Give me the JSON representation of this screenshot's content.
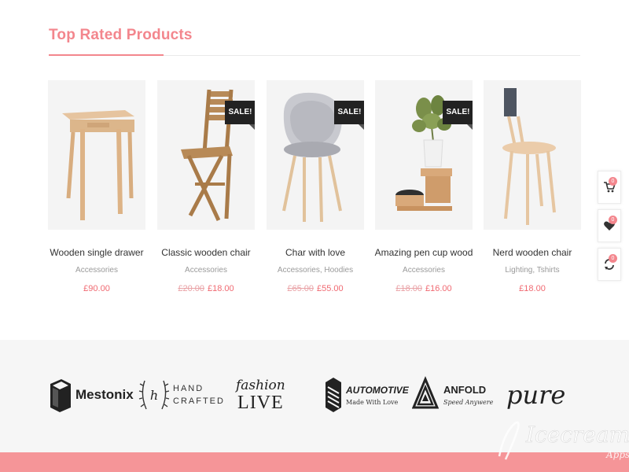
{
  "section": {
    "title": "Top Rated Products"
  },
  "products": [
    {
      "name": "Wooden single drawer",
      "category": "Accessories",
      "old_price": "",
      "price": "£90.00",
      "sale": ""
    },
    {
      "name": "Classic wooden chair",
      "category": "Accessories",
      "old_price": "£20.00",
      "price": "£18.00",
      "sale": "SALE!"
    },
    {
      "name": "Char with love",
      "category": "Accessories, Hoodies",
      "old_price": "£65.00",
      "price": "£55.00",
      "sale": "SALE!"
    },
    {
      "name": "Amazing pen cup wood",
      "category": "Accessories",
      "old_price": "£18.00",
      "price": "£16.00",
      "sale": "SALE!"
    },
    {
      "name": "Nerd wooden chair",
      "category": "Lighting, Tshirts",
      "old_price": "",
      "price": "£18.00",
      "sale": ""
    }
  ],
  "side_icons": [
    {
      "icon": "cart-icon",
      "count": "0"
    },
    {
      "icon": "heart-icon",
      "count": "0"
    },
    {
      "icon": "compare-icon",
      "count": "0"
    }
  ],
  "brands": {
    "mestonix": "Mestonix",
    "handcrafted_1": "HAND",
    "handcrafted_2": "CRAFTED",
    "handcrafted_mark": "h",
    "fashion_1": "fashion",
    "fashion_2": "LIVE",
    "automotive_1": "AUTOMOTIVE",
    "automotive_2": "Made With Love",
    "anfold_1": "ANFOLD",
    "anfold_2": "Speed Anywere",
    "pure": "pure"
  },
  "watermark": {
    "text": "Icecream",
    "sub": "Apps"
  },
  "colors": {
    "accent": "#f3868d",
    "price": "#f06a72",
    "footer": "#f59598"
  }
}
